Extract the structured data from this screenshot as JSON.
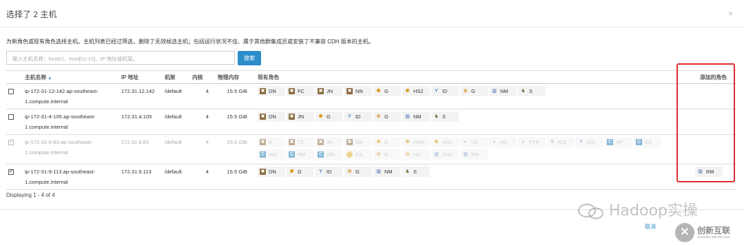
{
  "dialog": {
    "title": "选择了 2 主机",
    "close": "×",
    "description": "为新角色或现有角色选择主机。主机列表已经过筛选，删除了无效候选主机；包括运行状况不佳、属于其他群集成员或安装了不兼容 CDH 版本的主机。",
    "search_placeholder": "输入主机名称：host01、host[01-10]、IP 地址或机架。",
    "search_button": "搜索",
    "columns": {
      "hostname": "主机名称",
      "ip": "IP 地址",
      "rack": "机架",
      "cores": "内核",
      "memory": "物理内存",
      "existing_roles": "现有角色",
      "added_roles": "添加的角色"
    },
    "sort_indicator": "▲",
    "rows": [
      {
        "checked": false,
        "disabled": false,
        "host_line1": "ip-172-31-12-142.ap-southeast-",
        "host_line2": "1.compute.internal",
        "ip": "172.31.12.142",
        "rack": "/default",
        "cores": "4",
        "memory": "15.5 GiB",
        "roles": [
          [
            "db",
            "DN"
          ],
          [
            "db",
            "FC"
          ],
          [
            "db",
            "JN"
          ],
          [
            "db",
            "NN"
          ],
          [
            "g",
            "G"
          ],
          [
            "g",
            "HS2"
          ],
          [
            "zk",
            "ID"
          ],
          [
            "star",
            "G"
          ],
          [
            "nm",
            "NM"
          ],
          [
            "man",
            "S"
          ]
        ],
        "added": ""
      },
      {
        "checked": false,
        "disabled": false,
        "host_line1": "ip-172-31-4-105.ap-southeast-",
        "host_line2": "1.compute.internal",
        "ip": "172.31.4.105",
        "rack": "/default",
        "cores": "4",
        "memory": "15.5 GiB",
        "roles": [
          [
            "db",
            "DN"
          ],
          [
            "db",
            "JN"
          ],
          [
            "g",
            "G"
          ],
          [
            "zk",
            "ID"
          ],
          [
            "star",
            "G"
          ],
          [
            "nm",
            "NM"
          ],
          [
            "man",
            "S"
          ]
        ],
        "added": ""
      },
      {
        "checked": true,
        "disabled": true,
        "host_line1": "ip-172-31-6-83.ap-southeast-",
        "host_line2": "1.compute.internal",
        "ip": "172.31.6.83",
        "rack": "/default",
        "cores": "4",
        "memory": "15.5 GiB",
        "roles": [
          [
            "db",
            "B"
          ],
          [
            "db",
            "FC"
          ],
          [
            "db",
            "JN"
          ],
          [
            "db",
            "NN"
          ],
          [
            "g",
            "G"
          ],
          [
            "g",
            "HMS"
          ],
          [
            "g",
            "HS2"
          ],
          [
            "lb",
            "LB"
          ],
          [
            "lb",
            "HS"
          ],
          [
            "lb",
            "KTR"
          ],
          [
            "zk",
            "ICS"
          ],
          [
            "zk",
            "ISS"
          ],
          [
            "c",
            "AP"
          ],
          [
            "c",
            "ES"
          ],
          [
            "c",
            "HM"
          ],
          [
            "c",
            "RM"
          ],
          [
            "c",
            "SM"
          ],
          [
            "os",
            "OS"
          ],
          [
            "star",
            "G"
          ],
          [
            "star",
            "HS"
          ],
          [
            "nm",
            "JHS"
          ],
          [
            "nm",
            "RM"
          ]
        ],
        "added": ""
      },
      {
        "checked": true,
        "disabled": false,
        "host_line1": "ip-172-31-9-113.ap-southeast-",
        "host_line2": "1.compute.internal",
        "ip": "172.31.9.113",
        "rack": "/default",
        "cores": "4",
        "memory": "15.5 GiB",
        "roles": [
          [
            "db",
            "DN"
          ],
          [
            "g",
            "G"
          ],
          [
            "zk",
            "ID"
          ],
          [
            "star",
            "G"
          ],
          [
            "nm",
            "NM"
          ],
          [
            "man",
            "S"
          ]
        ],
        "added": "RM"
      }
    ],
    "footer": "Displaying 1 - 4 of 4",
    "cancel": "取消"
  },
  "watermarks": {
    "hadoop": "Hadoop实操",
    "brand_cn": "创新互联",
    "brand_en": "CHUANG XIN HU LIAN",
    "brand_mark": "✕"
  }
}
